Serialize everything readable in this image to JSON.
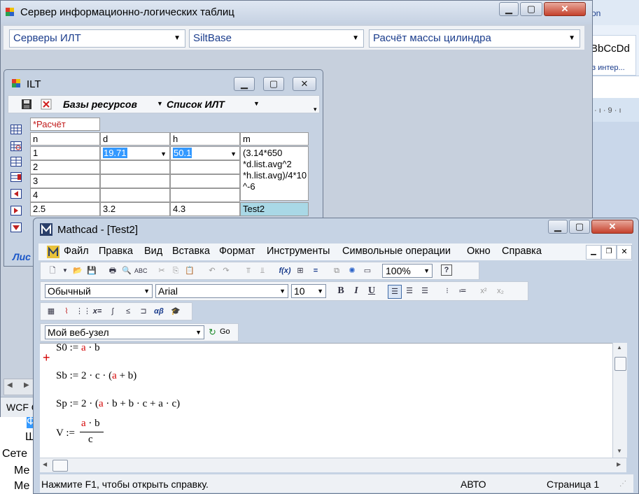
{
  "server_window": {
    "title": "Сервер информационно-логических таблиц",
    "combo_servers": "Серверы ИЛТ",
    "combo_base": "SiltBase",
    "combo_calc": "Расчёт массы цилиндра",
    "status_partial": "WCF C"
  },
  "background_app": {
    "ribbon_style_sample": "BbCcDd",
    "ribbon_style_caption": "з интер...",
    "ruler_text": "· ı · 9 · ı",
    "tab_fragment": "on",
    "bottom_lines": [
      "Ф",
      "Ш",
      "Сете",
      "Ме",
      "Ме"
    ]
  },
  "ilt_window": {
    "title": "ILT",
    "toolbar_bases": "Базы ресурсов",
    "toolbar_list": "Список ИЛТ",
    "table_title": "*Расчёт",
    "bottom_partial": "Лис",
    "headers": [
      "n",
      "d",
      "h",
      "m"
    ],
    "rows": [
      {
        "n": "1",
        "d": "19.71",
        "h": "50.1"
      },
      {
        "n": "2",
        "d": "",
        "h": ""
      },
      {
        "n": "3",
        "d": "",
        "h": ""
      },
      {
        "n": "4",
        "d": "",
        "h": ""
      }
    ],
    "formula_lines": [
      "(3.14*650",
      "*d.list.avg^2",
      "*h.list.avg)/4*10",
      "^-6"
    ],
    "summary_row": {
      "n": "2.5",
      "d": "3.2",
      "h": "4.3",
      "m": "Test2"
    }
  },
  "mathcad": {
    "title": "Mathcad - [Test2]",
    "menu": [
      "Файл",
      "Правка",
      "Вид",
      "Вставка",
      "Формат",
      "Инструменты",
      "Символьные операции",
      "Окно",
      "Справка"
    ],
    "zoom": "100%",
    "style": "Обычный",
    "font": "Arial",
    "font_size": "10",
    "bold_label": "B",
    "italic_label": "I",
    "underline_label": "U",
    "web_node": "Мой веб-узел",
    "go_label": "Go",
    "status_help": "Нажмите F1, чтобы открыть справку.",
    "status_mode": "АВТО",
    "status_page": "Страница 1",
    "eq_s0": {
      "lhs": "S0",
      "assign": ":=",
      "a": "a",
      "dot": "·",
      "b": "b"
    },
    "eq_sb": {
      "lhs": "Sb",
      "assign": ":=",
      "coef": "2",
      "dot1": "·",
      "c": "c",
      "dot2": "·",
      "open": "(",
      "a": "a",
      "plus": "+",
      "b": "b",
      "close": ")"
    },
    "eq_sp": {
      "lhs": "Sp",
      "assign": ":=",
      "coef": "2",
      "dot1": "·",
      "open": "(",
      "a": "a",
      "d2": "·",
      "b1": "b",
      "p1": "+",
      "b2": "b",
      "d3": "·",
      "c1": "c",
      "p2": "+",
      "a2": "a",
      "d4": "·",
      "c2": "c",
      "close": ")"
    },
    "eq_v": {
      "lhs": "V",
      "assign": ":=",
      "num_a": "a",
      "num_dot": "·",
      "num_b": "b",
      "den": "c"
    },
    "crosshair": "+"
  },
  "colors": {
    "accent_blue": "#1a3c8c",
    "selection": "#3399ff",
    "math_red": "#d40000",
    "close_red": "#c5412c"
  }
}
